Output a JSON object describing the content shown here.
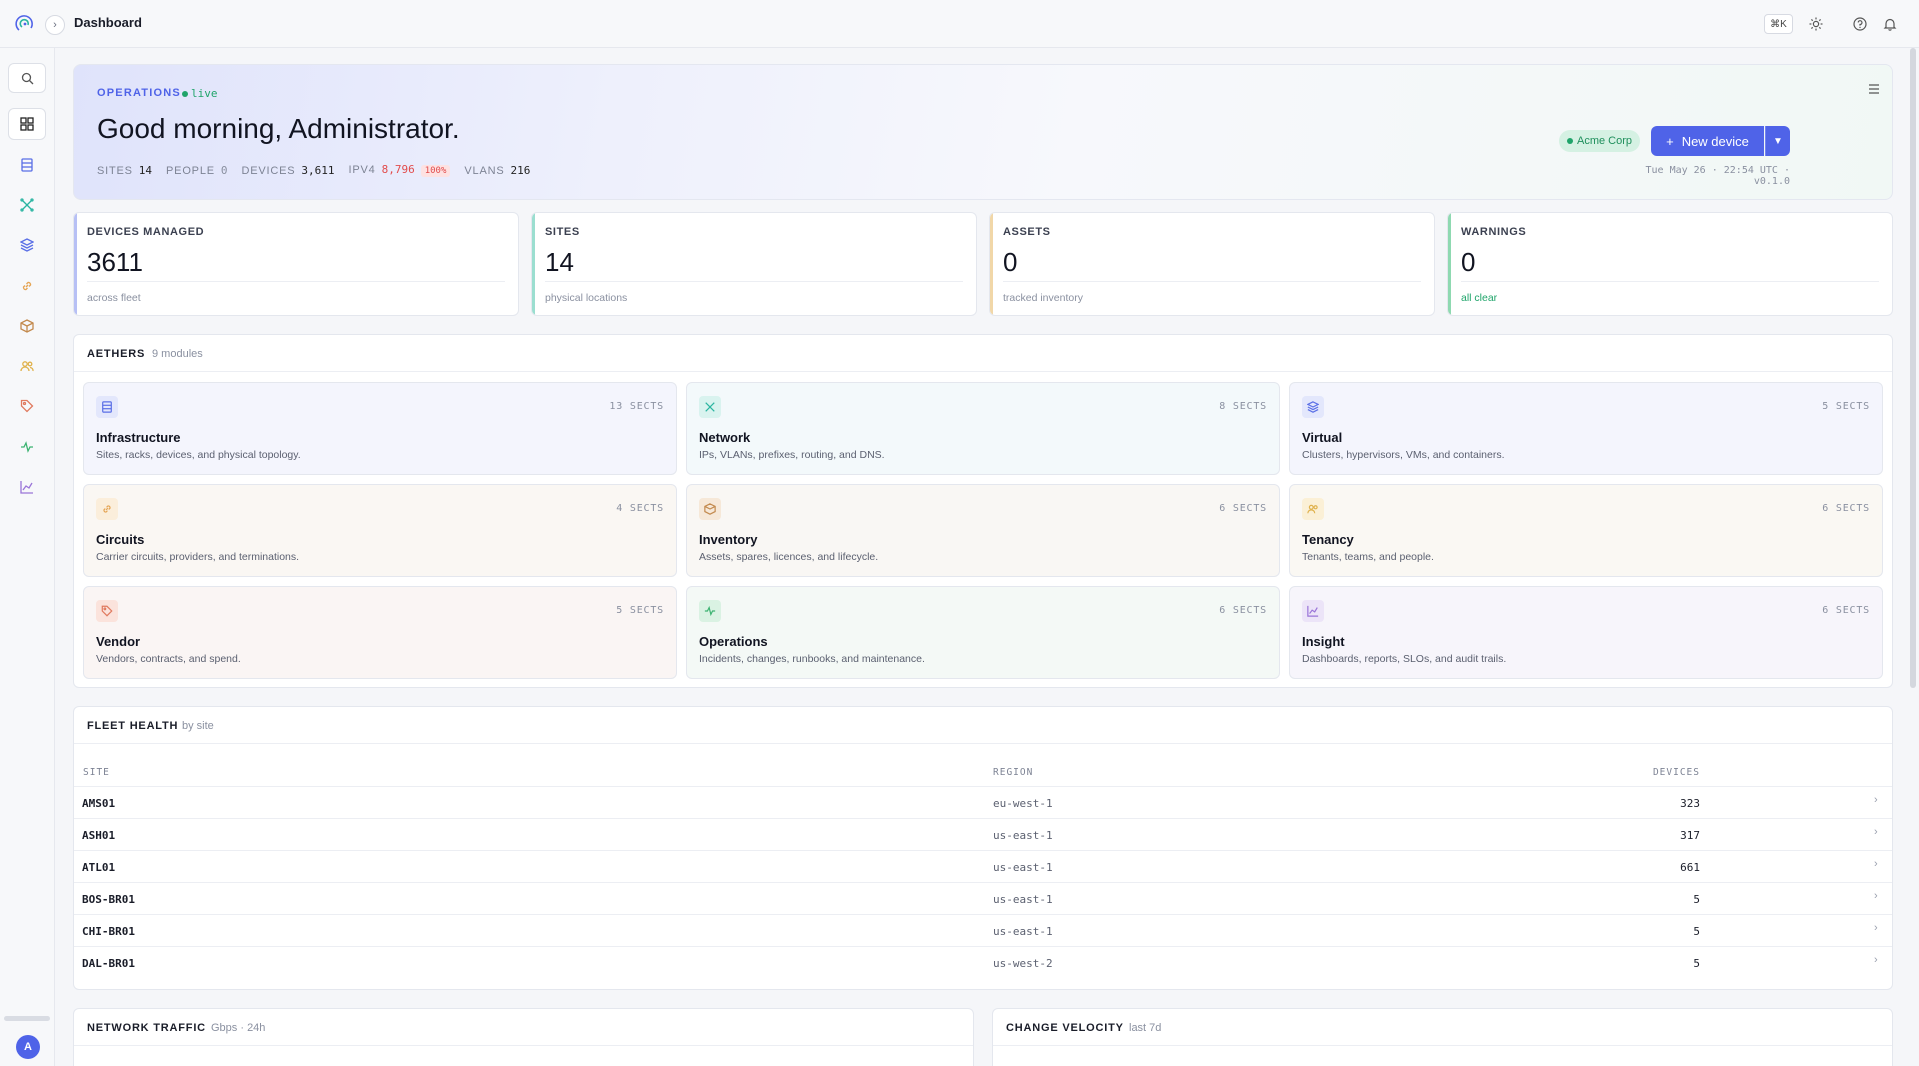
{
  "topbar": {
    "breadcrumb": "Dashboard",
    "shortcut": "⌘K",
    "icons": [
      "logo-icon",
      "chevron-right-icon",
      "sun-icon",
      "help-icon",
      "bell-icon"
    ]
  },
  "sidebar": {
    "items": [
      "search-icon",
      "grid-icon",
      "server-icon",
      "network-icon",
      "layers-icon",
      "link-icon",
      "box-icon",
      "users-icon",
      "tag-icon",
      "activity-icon",
      "chart-icon"
    ],
    "avatar": "A"
  },
  "hero": {
    "kicker": "OPERATIONS",
    "live": "live",
    "title": "Good morning, Administrator.",
    "stats": [
      {
        "label": "SITES",
        "value": "14"
      },
      {
        "label": "PEOPLE",
        "value": "0"
      },
      {
        "label": "DEVICES",
        "value": "3,611"
      },
      {
        "label": "IPV4",
        "value": "8,796",
        "badge": "100%"
      },
      {
        "label": "VLANS",
        "value": "216"
      }
    ],
    "org": "Acme Corp",
    "new_device": "New device",
    "meta": "Tue May 26 · 22:54 UTC · v0.1.0"
  },
  "kpis": [
    {
      "label": "DEVICES MANAGED",
      "value": "3611",
      "sub": "across fleet",
      "color": "#b7c0f5"
    },
    {
      "label": "SITES",
      "value": "14",
      "sub": "physical locations",
      "color": "#9bded0"
    },
    {
      "label": "ASSETS",
      "value": "0",
      "sub": "tracked inventory",
      "color": "#f1d7a8"
    },
    {
      "label": "WARNINGS",
      "value": "0",
      "sub": "all clear",
      "color": "#8fd9b1"
    }
  ],
  "aethers": {
    "title": "AETHERS",
    "subtitle": "9 modules",
    "modules": [
      {
        "name": "Infrastructure",
        "desc": "Sites, racks, devices, and physical topology.",
        "sects": "13 SECTS",
        "icon": "server-icon",
        "color": "#5a6fe6",
        "bg": "#e3e7fc",
        "card": "#f4f5fd"
      },
      {
        "name": "Network",
        "desc": "IPs, VLANs, prefixes, routing, and DNS.",
        "sects": "8 SECTS",
        "icon": "network-icon",
        "color": "#2bb5a1",
        "bg": "#d9f3ef",
        "card": "#f3f9fb"
      },
      {
        "name": "Virtual",
        "desc": "Clusters, hypervisors, VMs, and containers.",
        "sects": "5 SECTS",
        "icon": "layers-icon",
        "color": "#5a6fe6",
        "bg": "#e3e7fc",
        "card": "#f4f5fd"
      },
      {
        "name": "Circuits",
        "desc": "Carrier circuits, providers, and terminations.",
        "sects": "4 SECTS",
        "icon": "link-icon",
        "color": "#e5a453",
        "bg": "#fbeedb",
        "card": "#faf7f3"
      },
      {
        "name": "Inventory",
        "desc": "Assets, spares, licences, and lifecycle.",
        "sects": "6 SECTS",
        "icon": "box-icon",
        "color": "#c38a4e",
        "bg": "#f6e8d8",
        "card": "#f9f7f4"
      },
      {
        "name": "Tenancy",
        "desc": "Tenants, teams, and people.",
        "sects": "6 SECTS",
        "icon": "users-icon",
        "color": "#e0b24d",
        "bg": "#fbf0d6",
        "card": "#faf8f3"
      },
      {
        "name": "Vendor",
        "desc": "Vendors, contracts, and spend.",
        "sects": "5 SECTS",
        "icon": "tag-icon",
        "color": "#e07a5f",
        "bg": "#fbe3dc",
        "card": "#faf5f4"
      },
      {
        "name": "Operations",
        "desc": "Incidents, changes, runbooks, and maintenance.",
        "sects": "6 SECTS",
        "icon": "activity-icon",
        "color": "#3cb371",
        "bg": "#daf2e3",
        "card": "#f4f9f6"
      },
      {
        "name": "Insight",
        "desc": "Dashboards, reports, SLOs, and audit trails.",
        "sects": "6 SECTS",
        "icon": "chart-icon",
        "color": "#9a74d8",
        "bg": "#ece4f8",
        "card": "#f7f5fb"
      }
    ]
  },
  "fleet": {
    "title": "FLEET HEALTH",
    "subtitle": "by site",
    "columns": [
      "SITE",
      "REGION",
      "DEVICES"
    ],
    "rows": [
      {
        "site": "AMS01",
        "region": "eu-west-1",
        "devices": "323"
      },
      {
        "site": "ASH01",
        "region": "us-east-1",
        "devices": "317"
      },
      {
        "site": "ATL01",
        "region": "us-east-1",
        "devices": "661"
      },
      {
        "site": "BOS-BR01",
        "region": "us-east-1",
        "devices": "5"
      },
      {
        "site": "CHI-BR01",
        "region": "us-east-1",
        "devices": "5"
      },
      {
        "site": "DAL-BR01",
        "region": "us-west-2",
        "devices": "5"
      }
    ]
  },
  "traffic": {
    "title": "NETWORK TRAFFIC",
    "subtitle": "Gbps · 24h"
  },
  "velocity": {
    "title": "CHANGE VELOCITY",
    "subtitle": "last 7d"
  }
}
